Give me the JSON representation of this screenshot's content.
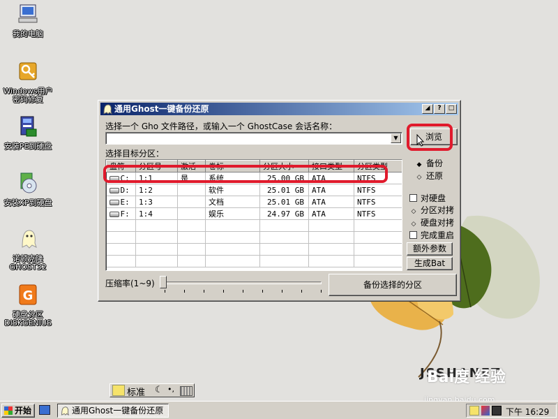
{
  "desktop": {
    "icons": [
      {
        "label": "我的电脑",
        "icon": "my-computer-icon"
      },
      {
        "label_lines": [
          "Windows用户",
          "密码修复"
        ],
        "icon": "key-icon"
      },
      {
        "label": "安装PE到硬盘",
        "icon": "installer-icon"
      },
      {
        "label": "安装XP到硬盘",
        "icon": "cd-install-icon"
      },
      {
        "label_lines": [
          "诺顿克隆",
          "GHOST32"
        ],
        "icon": "ghost-icon"
      },
      {
        "label_lines": [
          "硬盘分区",
          "DISKGENIUS"
        ],
        "icon": "diskgenius-icon"
      }
    ],
    "watermark": "JSSHANET",
    "watermark_brand": "Bai度 经验",
    "watermark_url": "jingyan.baidu.com"
  },
  "window": {
    "title": "通用Ghost一键备份还原",
    "path_prompt": "选择一个 Gho 文件路径，或输入一个 GhostCase 会话名称：",
    "path_value": "",
    "browse_label": "浏览",
    "target_label": "选择目标分区：",
    "columns": [
      "盘符",
      "分区号",
      "激活",
      "卷标",
      "分区大小",
      "接口类型",
      "分区类型"
    ],
    "rows": [
      {
        "drive": "C:",
        "num": "1:1",
        "active": "是",
        "volume": "系统",
        "size": "25.00 GB",
        "iface": "ATA",
        "fs": "NTFS"
      },
      {
        "drive": "D:",
        "num": "1:2",
        "active": "",
        "volume": "软件",
        "size": "25.01 GB",
        "iface": "ATA",
        "fs": "NTFS"
      },
      {
        "drive": "E:",
        "num": "1:3",
        "active": "",
        "volume": "文档",
        "size": "25.01 GB",
        "iface": "ATA",
        "fs": "NTFS"
      },
      {
        "drive": "F:",
        "num": "1:4",
        "active": "",
        "volume": "娱乐",
        "size": "24.97 GB",
        "iface": "ATA",
        "fs": "NTFS"
      }
    ],
    "mode_backup": "备份",
    "mode_restore": "还原",
    "selected_mode": "备份",
    "opt_disk_to_disk": "对硬盘",
    "opt_partition_to_partition": "分区对拷",
    "opt_disk_copy": "硬盘对拷",
    "opt_reboot": "完成重启",
    "extra_params": "额外参数",
    "gen_bat": "生成Bat",
    "compression_label": "压缩率(1~9)",
    "compression_level": 0,
    "action_button": "备份选择的分区"
  },
  "ime": {
    "mode": "标准"
  },
  "taskbar": {
    "start": "开始",
    "task": "通用Ghost一键备份还原",
    "clock": "下午 16:29"
  },
  "colors": {
    "titlebar": "#0a246a",
    "highlight": "#e01a2c",
    "face": "#d4d0c8"
  }
}
